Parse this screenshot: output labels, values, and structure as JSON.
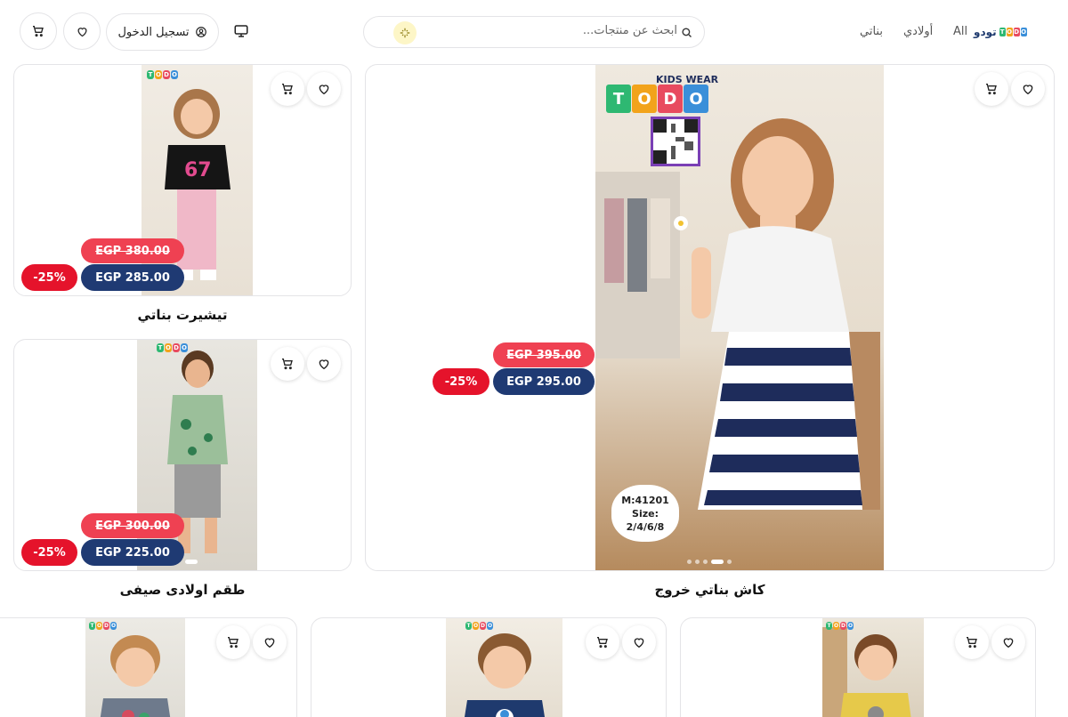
{
  "header": {
    "logo_text": "تودو",
    "logo_letters": [
      "T",
      "O",
      "D",
      "O"
    ],
    "nav": [
      "All",
      "أولادي",
      "بناتي"
    ],
    "search_placeholder": "ابحث عن منتجات...",
    "login_label": "تسجيل الدخول"
  },
  "featured": {
    "name": "كاش بناتي خروج",
    "old_price": "EGP 395.00",
    "new_price": "EGP 295.00",
    "discount": "-25%",
    "brand_caption": "KIDS WEAR",
    "model": "M:41201",
    "size_label": "Size:",
    "sizes": "2/4/6/8"
  },
  "side_products": [
    {
      "name": "تيشيرت بناتي",
      "old_price": "EGP 380.00",
      "new_price": "EGP 285.00",
      "discount": "-25%"
    },
    {
      "name": "طقم اولادى صيفى",
      "old_price": "EGP 300.00",
      "new_price": "EGP 225.00",
      "discount": "-25%"
    }
  ],
  "colors": {
    "old_price_bg": "#ef4152",
    "new_price_bg": "#1f3a73",
    "discount_bg": "#e5132b",
    "logo_t": "#2eb872",
    "logo_o": "#f2a31b",
    "logo_d": "#e84a5f",
    "logo_o2": "#3a8fd9"
  },
  "icons": [
    "cart-icon",
    "heart-icon",
    "user-icon",
    "monitor-icon",
    "search-icon",
    "sparkle-icon"
  ]
}
